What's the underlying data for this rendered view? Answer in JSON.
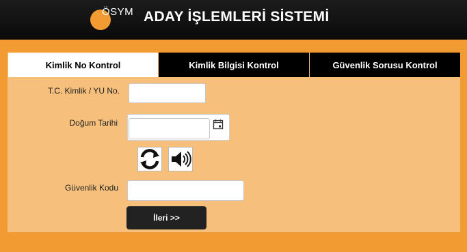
{
  "header": {
    "logo_text": "ÖSYM",
    "title": "ADAY İŞLEMLERİ SİSTEMİ"
  },
  "tabs": [
    {
      "label": "Kimlik No Kontrol",
      "active": true
    },
    {
      "label": "Kimlik Bilgisi Kontrol",
      "active": false
    },
    {
      "label": "Güvenlik Sorusu Kontrol",
      "active": false
    }
  ],
  "form": {
    "tc_label": "T.C. Kimlik / YU No.",
    "tc_value": "",
    "birth_label": "Doğum Tarihi",
    "birth_value": "",
    "security_label": "Güvenlik Kodu",
    "security_value": "",
    "next_label": "İleri >>"
  },
  "colors": {
    "accent": "#f39b33",
    "panel": "#f6bf7b",
    "header": "#111111"
  },
  "icons": {
    "calendar": "calendar-icon",
    "refresh": "refresh-captcha-icon",
    "audio": "audio-captcha-icon"
  }
}
